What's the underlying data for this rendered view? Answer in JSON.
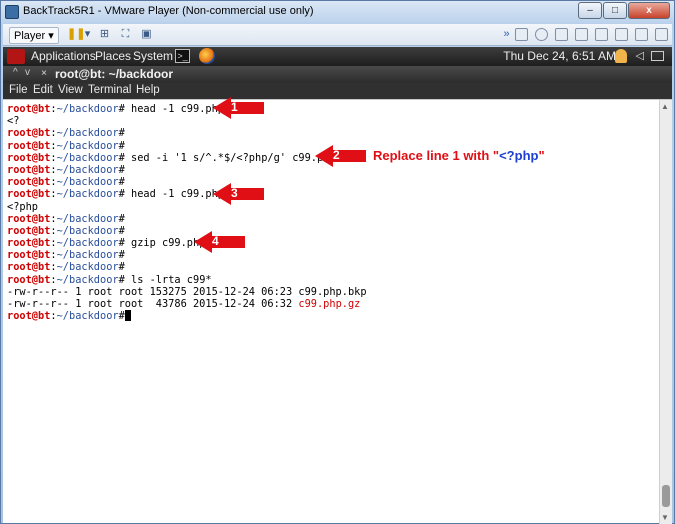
{
  "vmware": {
    "title": "BackTrack5R1 - VMware Player (Non-commercial use only)",
    "window_buttons": {
      "minimize": "–",
      "maximize": "□",
      "close": "x"
    },
    "player_menu": "Player ▾"
  },
  "gnome_panel": {
    "applications": "Applications",
    "places": "Places",
    "system": "System",
    "datetime": "Thu Dec 24,  6:51 AM"
  },
  "terminal": {
    "title": "root@bt: ~/backdoor",
    "controls": {
      "up": "^",
      "down": "v",
      "close": "×"
    },
    "menu": [
      "File",
      "Edit",
      "View",
      "Terminal",
      "Help"
    ]
  },
  "prompt": {
    "user": "root@bt",
    "sep": ":",
    "path": "~/backdoor",
    "symbol": "#"
  },
  "lines": [
    {
      "type": "prompt",
      "cmd": " head -1 c99.php"
    },
    {
      "type": "output",
      "text": "<?"
    },
    {
      "type": "prompt",
      "cmd": ""
    },
    {
      "type": "prompt",
      "cmd": ""
    },
    {
      "type": "prompt",
      "cmd": " sed -i '1 s/^.*$/<?php/g' c99.php"
    },
    {
      "type": "prompt",
      "cmd": ""
    },
    {
      "type": "prompt",
      "cmd": ""
    },
    {
      "type": "prompt",
      "cmd": " head -1 c99.php"
    },
    {
      "type": "output",
      "text": "<?php"
    },
    {
      "type": "prompt",
      "cmd": ""
    },
    {
      "type": "prompt",
      "cmd": ""
    },
    {
      "type": "prompt",
      "cmd": " gzip c99.php"
    },
    {
      "type": "prompt",
      "cmd": ""
    },
    {
      "type": "prompt",
      "cmd": ""
    },
    {
      "type": "prompt",
      "cmd": " ls -lrta c99*"
    },
    {
      "type": "output",
      "text": "-rw-r--r-- 1 root root 153275 2015-12-24 06:23 c99.php.bkp"
    },
    {
      "type": "listing",
      "text": "-rw-r--r-- 1 root root  43786 2015-12-24 06:32 ",
      "highlight": "c99.php.gz"
    },
    {
      "type": "prompt",
      "cmd": "",
      "cursor": true
    }
  ],
  "annotations": {
    "step1": "1",
    "step2": "2",
    "step3": "3",
    "step4": "4",
    "note_prefix": "Replace line 1 with \"",
    "note_code": "<?php",
    "note_suffix": "\""
  },
  "colors": {
    "prompt_user": "#d00000",
    "prompt_path": "#2b4f9a",
    "annotation_red": "#e00f16",
    "annotation_blue": "#1d3fcf"
  }
}
